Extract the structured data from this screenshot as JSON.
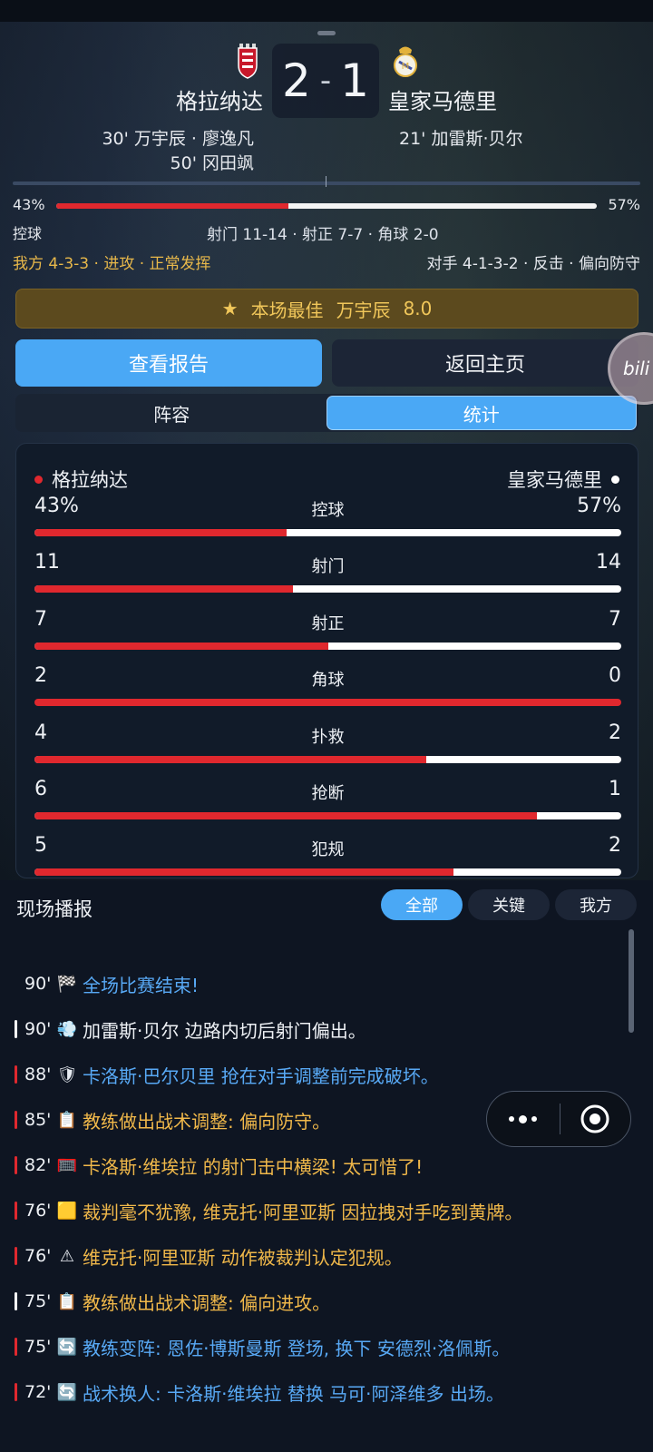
{
  "match": {
    "home_team": "格拉纳达",
    "away_team": "皇家马德里",
    "home_score": "2",
    "away_score": "1",
    "score_sep": "-",
    "home_scorers": [
      "30' 万宇辰 · 廖逸凡",
      "50' 冈田飒"
    ],
    "away_scorers": [
      "21' 加雷斯·贝尔"
    ]
  },
  "summary_bar": {
    "home_possession": "43%",
    "away_possession": "57%",
    "home_possession_fraction": 0.43,
    "possession_label": "控球",
    "summary_text": "射门 11-14  ·  射正 7-7  ·  角球 2-0",
    "home_formation": "我方 4-3-3 · 进攻 · 正常发挥",
    "away_formation": "对手 4-1-3-2 · 反击 · 偏向防守"
  },
  "motm": {
    "star": "★",
    "label": "本场最佳",
    "player": "万宇辰",
    "rating": "8.0"
  },
  "buttons": {
    "report": "查看报告",
    "home": "返回主页"
  },
  "tabs": [
    {
      "label": "阵容",
      "active": false
    },
    {
      "label": "统计",
      "active": true
    }
  ],
  "stats": {
    "home_team": "格拉纳达",
    "away_team": "皇家马德里",
    "rows": [
      {
        "name": "控球",
        "home": "43%",
        "away": "57%",
        "home_fraction": 0.43
      },
      {
        "name": "射门",
        "home": "11",
        "away": "14",
        "home_fraction": 0.44
      },
      {
        "name": "射正",
        "home": "7",
        "away": "7",
        "home_fraction": 0.5
      },
      {
        "name": "角球",
        "home": "2",
        "away": "0",
        "home_fraction": 1.0
      },
      {
        "name": "扑救",
        "home": "4",
        "away": "2",
        "home_fraction": 0.667
      },
      {
        "name": "抢断",
        "home": "6",
        "away": "1",
        "home_fraction": 0.857
      },
      {
        "name": "犯规",
        "home": "5",
        "away": "2",
        "home_fraction": 0.714
      }
    ]
  },
  "feed": {
    "title": "现场播报",
    "filters": [
      {
        "label": "全部",
        "active": true
      },
      {
        "label": "关键",
        "active": false
      },
      {
        "label": "我方",
        "active": false
      }
    ],
    "events": [
      {
        "minute": "90'",
        "icon": "checkered-flag-icon",
        "glyph": "🏁",
        "text": "全场比赛结束!",
        "color": "#58a9f5",
        "tick": "none"
      },
      {
        "minute": "90'",
        "icon": "shot-icon",
        "glyph": "💨",
        "text": "加雷斯·贝尔 边路内切后射门偏出。",
        "color": "#eef1f5",
        "tick": "white"
      },
      {
        "minute": "88'",
        "icon": "shield-icon",
        "glyph": "🛡",
        "text": "卡洛斯·巴尔贝里 抢在对手调整前完成破坏。",
        "color": "#58a9f5",
        "tick": "red"
      },
      {
        "minute": "85'",
        "icon": "clipboard-icon",
        "glyph": "📋",
        "text": "教练做出战术调整: 偏向防守。",
        "color": "#f0b84a",
        "tick": "red"
      },
      {
        "minute": "82'",
        "icon": "goal-frame-icon",
        "glyph": "🥅",
        "text": "卡洛斯·维埃拉 的射门击中横梁! 太可惜了!",
        "color": "#f0b84a",
        "tick": "red"
      },
      {
        "minute": "76'",
        "icon": "yellow-card-icon",
        "glyph": "🟨",
        "text": "裁判毫不犹豫, 维克托·阿里亚斯 因拉拽对手吃到黄牌。",
        "color": "#f0b84a",
        "tick": "red"
      },
      {
        "minute": "76'",
        "icon": "warning-icon",
        "glyph": "⚠",
        "text": "维克托·阿里亚斯 动作被裁判认定犯规。",
        "color": "#f0b84a",
        "tick": "red"
      },
      {
        "minute": "75'",
        "icon": "clipboard-icon",
        "glyph": "📋",
        "text": "教练做出战术调整: 偏向进攻。",
        "color": "#f0b84a",
        "tick": "white"
      },
      {
        "minute": "75'",
        "icon": "substitution-icon",
        "glyph": "🔄",
        "text": "教练变阵: 恩佐·博斯曼斯 登场, 换下 安德烈·洛佩斯。",
        "color": "#58a9f5",
        "tick": "red"
      },
      {
        "minute": "72'",
        "icon": "substitution-icon",
        "glyph": "🔄",
        "text": "战术换人: 卡洛斯·维埃拉 替换 马可·阿泽维多 出场。",
        "color": "#58a9f5",
        "tick": "red"
      }
    ]
  },
  "floating": {
    "bili_text": "bili"
  },
  "colors": {
    "home_red": "#e0282e",
    "accent_blue": "#4aa8f5",
    "gold": "#f0b84a"
  }
}
